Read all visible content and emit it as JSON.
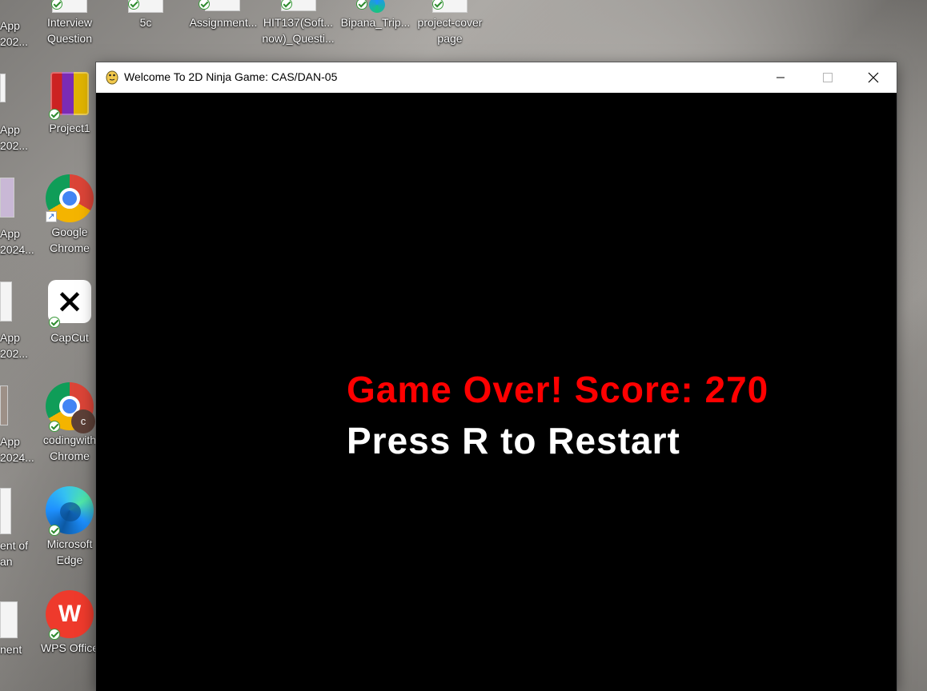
{
  "window": {
    "title": "Welcome To 2D Ninja Game: CAS/DAN-05"
  },
  "game": {
    "game_over_text": "Game Over! Score: 270",
    "restart_text": "Press R to Restart",
    "colors": {
      "game_over": "#ff0000",
      "restart": "#ffffff",
      "background": "#000000"
    }
  },
  "desktop": {
    "top_row": [
      {
        "line1": "Interview",
        "line2": "Question"
      },
      {
        "line1": "5c",
        "line2": ""
      },
      {
        "line1": "Assignment...",
        "line2": ""
      },
      {
        "line1": "HIT137(Soft...",
        "line2": "now)_Questi..."
      },
      {
        "line1": "Bipana_Trip...",
        "line2": ""
      },
      {
        "line1": "project-cover",
        "line2": "page"
      }
    ],
    "left_partial": [
      {
        "line1": "App",
        "line2": "202..."
      },
      {
        "line1": "App",
        "line2": "202..."
      },
      {
        "line1": "App",
        "line2": "2024..."
      },
      {
        "line1": "App",
        "line2": "202..."
      },
      {
        "line1": "App",
        "line2": "2024..."
      },
      {
        "line1": "ent of",
        "line2": "an"
      },
      {
        "line1": "nent",
        "line2": ""
      }
    ],
    "icons": [
      {
        "line1": "Project1",
        "line2": "",
        "icon": "winrar-icon"
      },
      {
        "line1": "Google",
        "line2": "Chrome",
        "icon": "chrome-icon"
      },
      {
        "line1": "CapCut",
        "line2": "",
        "icon": "capcut-icon"
      },
      {
        "line1": "codingwith",
        "line2": "Chrome",
        "icon": "chrome-profile-icon",
        "badge": "c"
      },
      {
        "line1": "Microsoft",
        "line2": "Edge",
        "icon": "edge-icon"
      },
      {
        "line1": "WPS Office",
        "line2": "",
        "icon": "wps-office-icon"
      }
    ]
  }
}
